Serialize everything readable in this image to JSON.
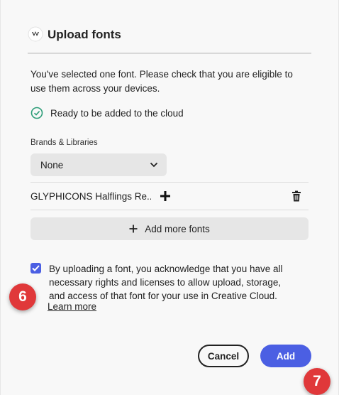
{
  "dialog": {
    "title": "Upload fonts",
    "description": "You've selected one font. Please check that you are eligible to use them across your devices.",
    "status_text": "Ready to be added to the cloud",
    "brands_label": "Brands & Libraries",
    "brands_selected": "None",
    "font_name": "GLYPHICONS Halflings Re...",
    "add_more_label": "Add more fonts",
    "consent_checked": true,
    "consent_text": "By uploading a font, you acknowledge that you have all necessary rights and licenses to allow upload, storage, and access of that font for your use in Creative Cloud.",
    "learn_more": "Learn more",
    "cancel_label": "Cancel",
    "add_label": "Add"
  },
  "annotations": {
    "badge_6": "6",
    "badge_7": "7"
  },
  "colors": {
    "accent": "#4b5fe3",
    "badge": "#e0383a",
    "success": "#2d9d78"
  },
  "icons": [
    "creative-cloud-fonts-icon",
    "check-circle-icon",
    "chevron-down-icon",
    "plus-icon",
    "trash-icon",
    "checkmark-icon"
  ]
}
